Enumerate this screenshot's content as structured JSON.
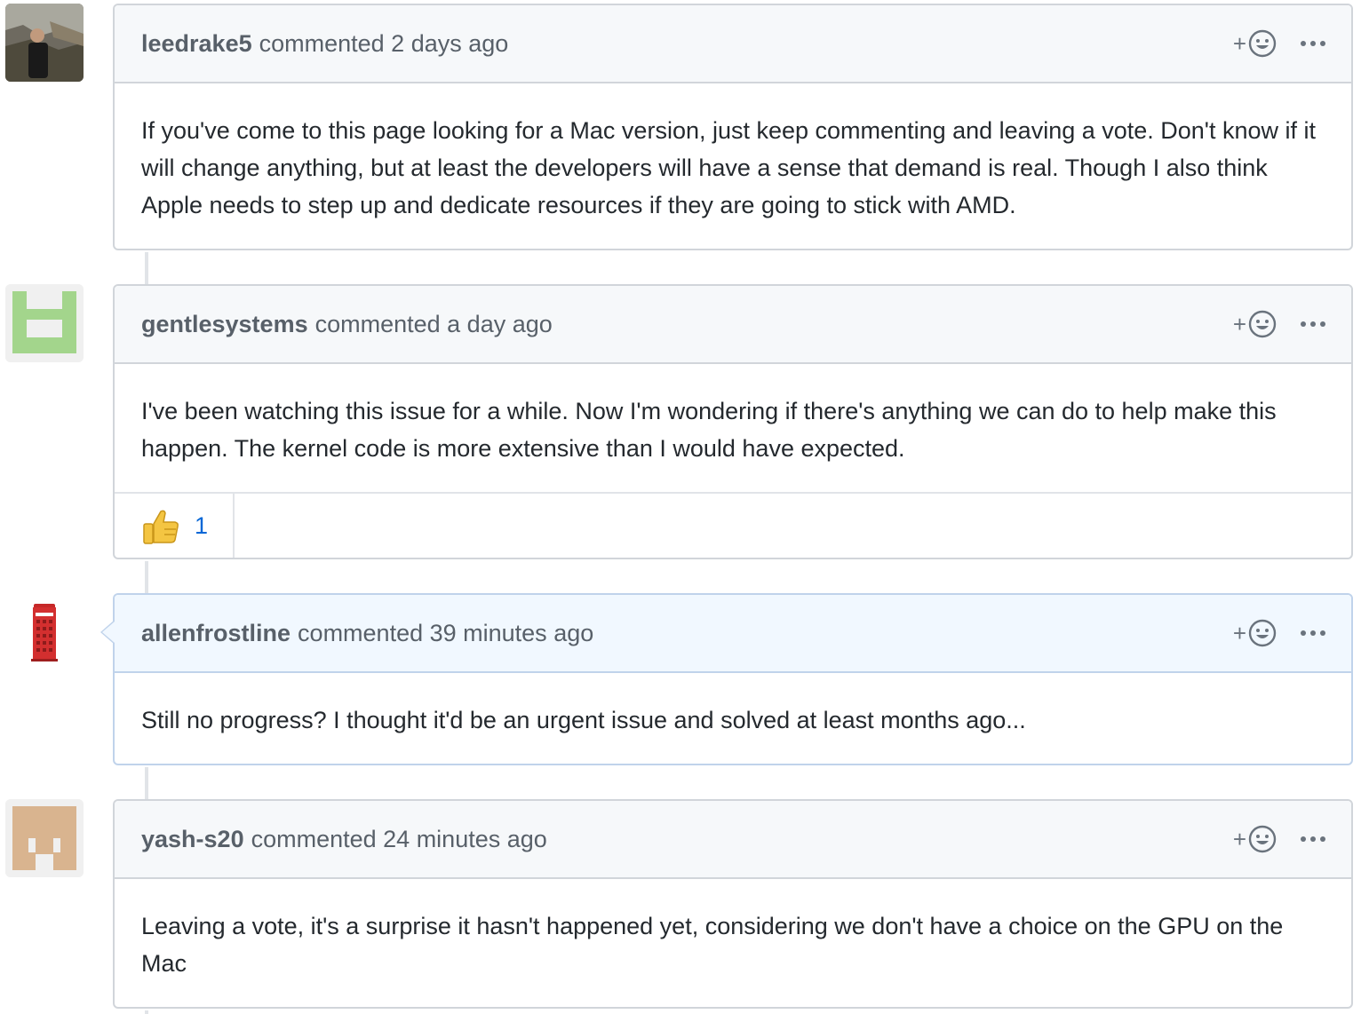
{
  "comments": [
    {
      "author": "leedrake5",
      "meta": "commented 2 days ago",
      "body": "If you've come to this page looking for a Mac version, just keep commenting and leaving a vote. Don't know if it will change anything, but at least the developers will have a sense that demand is real. Though I also think Apple needs to step up and dedicate resources if they are going to stick with AMD."
    },
    {
      "author": "gentlesystems",
      "meta": "commented a day ago",
      "body": "I've been watching this issue for a while. Now I'm wondering if there's anything we can do to help make this happen. The kernel code is more extensive than I would have expected.",
      "reaction": {
        "icon": "thumbs-up-icon",
        "count": "1"
      }
    },
    {
      "author": "allenfrostline",
      "meta": "commented 39 minutes ago",
      "body": "Still no progress? I thought it'd be an urgent issue and solved at least months ago..."
    },
    {
      "author": "yash-s20",
      "meta": "commented 24 minutes ago",
      "body": "Leaving a vote, it's a surprise it hasn't happened yet, considering we don't have a choice on the GPU on the Mac"
    }
  ],
  "colors": {
    "border": "#d1d5da",
    "highlight_border": "#c0d3eb",
    "highlight_header": "#f1f8ff",
    "link_blue": "#0366d6"
  }
}
